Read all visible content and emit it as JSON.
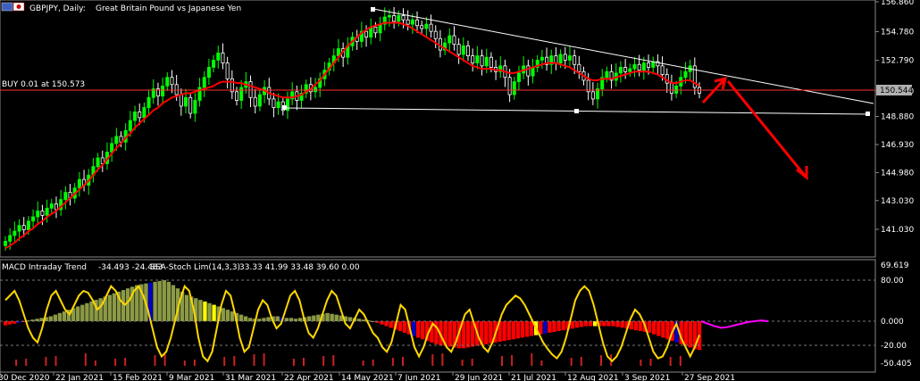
{
  "header": {
    "symbol": "GBPJPY, Daily:",
    "description": "Great Britain Pound vs Japanese Yen"
  },
  "trade_line": {
    "label": "BUY 0.01 at 150.573",
    "price": 150.573
  },
  "current_price": {
    "label": "150.544",
    "value": 150.544
  },
  "indicator": {
    "name": "MACD Intraday Trend",
    "values": "-34.493 -24.483",
    "name2": "SSA-Stoch Lim(14,3,3)",
    "values2": "33.33 41.99 33.48 39.60 0.00"
  },
  "colors": {
    "background": "#000000",
    "bull_candle": "#00ff00",
    "bear_candle": "#ffffff",
    "ma_line": "#ff0000",
    "trend_line": "#ffffff",
    "trade_line": "#ff3030",
    "arrow": "#ff0000",
    "stoch": "#ffd700",
    "macd_green": "#8b9a46",
    "macd_red": "#ff0000",
    "macd_blue": "#0000cc",
    "macd_yellow": "#ffff00",
    "forecast": "#ff00ff"
  },
  "chart_data": [
    {
      "type": "candlestick",
      "title": "GBPJPY, Daily: Great Britain Pound vs Japanese Yen",
      "ylim": [
        140.0,
        156.86
      ],
      "y_ticks": [
        "156.860",
        "154.780",
        "152.790",
        "150.640",
        "148.880",
        "146.930",
        "144.980",
        "143.030",
        "141.030"
      ],
      "x_ticks": [
        "30 Dec 2020",
        "22 Jan 2021",
        "15 Feb 2021",
        "9 Mar 2021",
        "31 Mar 2021",
        "22 Apr 2021",
        "14 May 2021",
        "7 Jun 2021",
        "29 Jun 2021",
        "21 Jul 2021",
        "12 Aug 2021",
        "3 Sep 2021",
        "27 Sep 2021"
      ],
      "series": [
        {
          "name": "Close",
          "values": [
            140.2,
            140.6,
            140.9,
            141.3,
            141.0,
            141.6,
            141.9,
            142.3,
            142.0,
            142.5,
            142.8,
            142.4,
            143.1,
            143.6,
            143.2,
            143.9,
            144.5,
            144.1,
            144.8,
            145.4,
            146.0,
            145.6,
            146.4,
            147.0,
            147.5,
            147.1,
            147.9,
            148.6,
            149.2,
            148.8,
            149.5,
            150.2,
            150.8,
            150.3,
            151.0,
            151.6,
            151.1,
            150.4,
            149.6,
            150.2,
            149.1,
            150.0,
            150.9,
            151.6,
            152.3,
            152.8,
            153.3,
            152.6,
            151.5,
            150.6,
            150.0,
            150.9,
            151.3,
            150.2,
            149.6,
            150.4,
            150.9,
            150.1,
            149.5,
            149.9,
            149.3,
            150.1,
            150.6,
            150.0,
            150.5,
            151.1,
            150.6,
            150.9,
            151.5,
            152.1,
            152.6,
            153.1,
            153.6,
            153.0,
            153.8,
            154.4,
            154.1,
            154.8,
            154.4,
            155.1,
            154.7,
            155.3,
            155.8,
            155.9,
            155.5,
            155.9,
            155.6,
            155.3,
            155.6,
            155.2,
            155.0,
            155.3,
            154.8,
            154.3,
            153.5,
            154.0,
            154.5,
            153.9,
            153.2,
            153.8,
            153.1,
            152.6,
            153.1,
            152.4,
            153.0,
            152.3,
            152.0,
            152.4,
            151.6,
            150.4,
            151.3,
            151.9,
            152.4,
            151.7,
            152.3,
            152.8,
            153.0,
            152.5,
            153.1,
            152.6,
            153.2,
            152.8,
            153.1,
            152.5,
            152.0,
            151.4,
            150.6,
            150.1,
            150.8,
            151.6,
            152.0,
            151.4,
            151.9,
            152.3,
            152.0,
            152.2,
            152.5,
            152.1,
            152.6,
            152.3,
            152.7,
            152.4,
            151.8,
            151.2,
            150.5,
            151.0,
            151.6,
            152.0,
            152.4,
            150.9,
            150.5
          ]
        },
        {
          "name": "MA",
          "values": [
            139.7,
            139.9,
            140.1,
            140.4,
            140.6,
            140.9,
            141.1,
            141.4,
            141.6,
            141.9,
            142.1,
            142.3,
            142.6,
            142.9,
            143.2,
            143.5,
            143.8,
            144.1,
            144.4,
            144.8,
            145.2,
            145.5,
            145.9,
            146.3,
            146.7,
            147.0,
            147.4,
            147.7,
            148.1,
            148.4,
            148.7,
            149.0,
            149.3,
            149.5,
            149.8,
            150.0,
            150.2,
            150.3,
            150.4,
            150.5,
            150.5,
            150.6,
            150.7,
            150.8,
            150.9,
            151.0,
            151.2,
            151.3,
            151.3,
            151.3,
            151.2,
            151.2,
            151.1,
            151.0,
            150.9,
            150.8,
            150.7,
            150.5,
            150.4,
            150.3,
            150.2,
            150.2,
            150.2,
            150.3,
            150.4,
            150.6,
            150.8,
            151.1,
            151.4,
            151.8,
            152.2,
            152.6,
            153.0,
            153.4,
            153.8,
            154.1,
            154.4,
            154.7,
            154.9,
            155.1,
            155.2,
            155.3,
            155.4,
            155.4,
            155.4,
            155.4,
            155.3,
            155.2,
            155.0,
            154.8,
            154.6,
            154.4,
            154.2,
            154.0,
            153.8,
            153.6,
            153.4,
            153.2,
            153.0,
            152.8,
            152.6,
            152.4,
            152.3,
            152.2,
            152.2,
            152.2,
            152.1,
            152.1,
            152.0,
            151.9,
            151.9,
            152.0,
            152.1,
            152.2,
            152.3,
            152.4,
            152.5,
            152.6,
            152.6,
            152.6,
            152.5,
            152.4,
            152.3,
            152.1,
            151.9,
            151.7,
            151.5,
            151.4,
            151.4,
            151.5,
            151.5,
            151.5,
            151.6,
            151.7,
            151.8,
            151.9,
            152.0,
            152.0,
            152.0,
            152.0,
            151.9,
            151.8,
            151.6,
            151.4,
            151.2,
            151.2,
            151.3,
            151.4,
            151.4,
            151.2,
            151.0
          ]
        }
      ]
    },
    {
      "type": "bar",
      "title": "MACD Intraday Trend / SSA-Stoch Lim(14,3,3)",
      "ylim": [
        -50.405,
        69.619
      ],
      "y_ticks": [
        "69.619",
        "80.00",
        "0.000",
        "-20.00",
        "-50.405"
      ],
      "series": [
        {
          "name": "histogram",
          "values": [
            -5,
            -4,
            -3,
            -2,
            -1,
            1,
            2,
            3,
            4,
            5,
            6,
            8,
            10,
            12,
            14,
            16,
            18,
            20,
            22,
            24,
            26,
            28,
            30,
            32,
            34,
            36,
            38,
            40,
            42,
            44,
            45,
            46,
            47,
            48,
            49,
            50,
            48,
            44,
            40,
            36,
            32,
            30,
            28,
            26,
            24,
            22,
            20,
            18,
            16,
            14,
            12,
            10,
            8,
            6,
            4,
            3,
            3,
            4,
            5,
            6,
            6,
            5,
            4,
            4,
            3,
            4,
            5,
            6,
            7,
            8,
            9,
            10,
            9,
            8,
            7,
            6,
            5,
            4,
            3,
            2,
            1,
            0,
            -2,
            -4,
            -6,
            -8,
            -10,
            -12,
            -14,
            -16,
            -18,
            -20,
            -22,
            -24,
            -26,
            -28,
            -29,
            -30,
            -31,
            -32,
            -33,
            -33,
            -32,
            -31,
            -30,
            -29,
            -28,
            -27,
            -26,
            -25,
            -24,
            -23,
            -22,
            -21,
            -20,
            -19,
            -18,
            -17,
            -16,
            -15,
            -14,
            -13,
            -12,
            -11,
            -10,
            -9,
            -8,
            -7,
            -6,
            -6,
            -6,
            -6,
            -6,
            -6,
            -6,
            -7,
            -8,
            -9,
            -10,
            -11,
            -12,
            -13,
            -14,
            -16,
            -18,
            -20,
            -22,
            -24,
            -26,
            -28,
            -30,
            -32,
            -34,
            -35
          ]
        },
        {
          "name": "stoch",
          "values": [
            70,
            75,
            80,
            70,
            55,
            40,
            30,
            25,
            40,
            60,
            75,
            80,
            70,
            60,
            55,
            65,
            75,
            80,
            78,
            70,
            60,
            65,
            75,
            85,
            80,
            70,
            65,
            70,
            80,
            85,
            75,
            60,
            40,
            20,
            10,
            15,
            30,
            50,
            70,
            85,
            80,
            60,
            30,
            10,
            5,
            15,
            40,
            65,
            80,
            75,
            55,
            30,
            15,
            20,
            40,
            60,
            70,
            65,
            50,
            40,
            45,
            60,
            75,
            80,
            70,
            50,
            35,
            30,
            40,
            55,
            70,
            80,
            75,
            60,
            45,
            40,
            50,
            60,
            55,
            45,
            35,
            30,
            20,
            15,
            25,
            45,
            65,
            60,
            40,
            20,
            10,
            20,
            35,
            45,
            40,
            30,
            20,
            15,
            25,
            40,
            55,
            60,
            45,
            30,
            20,
            15,
            25,
            40,
            55,
            65,
            70,
            75,
            72,
            65,
            55,
            45,
            35,
            25,
            18,
            12,
            8,
            15,
            30,
            50,
            70,
            80,
            85,
            80,
            65,
            45,
            25,
            10,
            5,
            10,
            20,
            35,
            50,
            60,
            55,
            45,
            30,
            15,
            8,
            10,
            20,
            35,
            45,
            30,
            20,
            10,
            20,
            33
          ]
        },
        {
          "name": "forecast",
          "values": [
            0,
            -3,
            -6,
            -8,
            -7,
            -5,
            -3,
            -1,
            0,
            1,
            0
          ]
        }
      ]
    }
  ]
}
